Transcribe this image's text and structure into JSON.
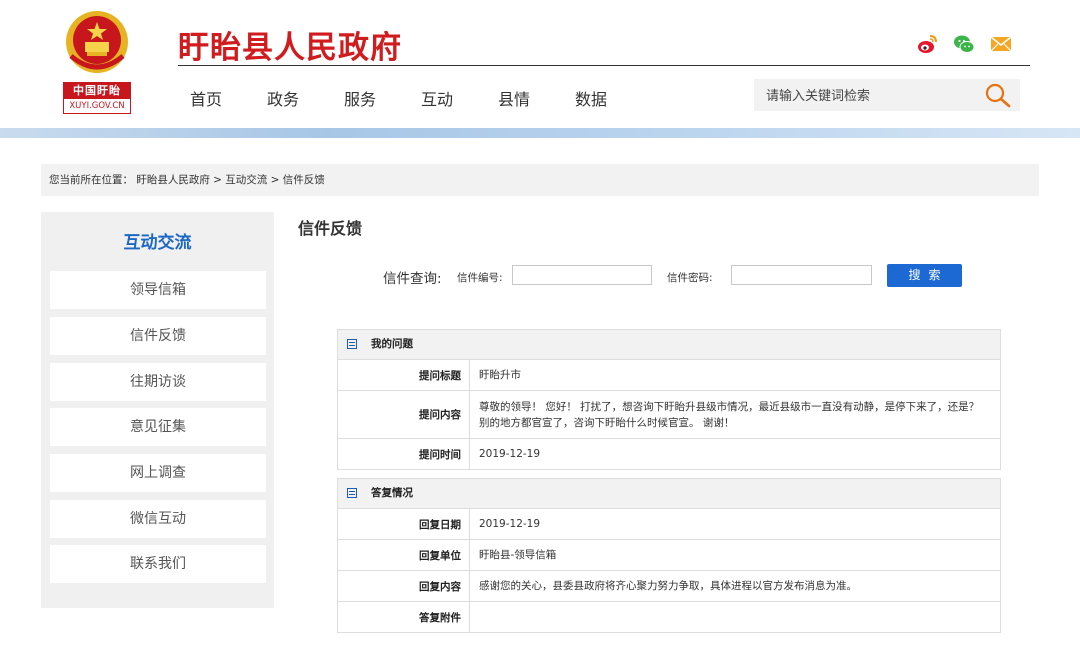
{
  "header": {
    "badge_top": "中国盱眙",
    "badge_bottom": "XUYI.GOV.CN",
    "site_title": "盱眙县人民政府",
    "social_icons": [
      "weibo-icon",
      "wechat-icon",
      "mail-icon"
    ]
  },
  "nav": {
    "items": [
      "首页",
      "政务",
      "服务",
      "互动",
      "县情",
      "数据"
    ]
  },
  "search": {
    "placeholder": "请输入关键词检索"
  },
  "breadcrumb": {
    "text": "您当前所在位置： 盱眙县人民政府 > 互动交流 > 信件反馈"
  },
  "sidebar": {
    "title": "互动交流",
    "items": [
      "领导信箱",
      "信件反馈",
      "往期访谈",
      "意见征集",
      "网上调查",
      "微信互动",
      "联系我们"
    ]
  },
  "main": {
    "title": "信件反馈",
    "query_label": "信件查询:",
    "number_label": "信件编号:",
    "password_label": "信件密码:",
    "search_button": "搜索"
  },
  "question": {
    "heading": "我的问题",
    "rows": [
      {
        "key": "提问标题",
        "value": "盱眙升市"
      },
      {
        "key": "提问内容",
        "value": "尊敬的领导！ 您好！ 打扰了，想咨询下盱眙升县级市情况，最近县级市一直没有动静，是停下来了，还是？别的地方都官宣了，咨询下盱眙什么时候官宣。 谢谢！"
      },
      {
        "key": "提问时间",
        "value": "2019-12-19"
      }
    ]
  },
  "reply": {
    "heading": "答复情况",
    "rows": [
      {
        "key": "回复日期",
        "value": "2019-12-19"
      },
      {
        "key": "回复单位",
        "value": "盱眙县-领导信箱"
      },
      {
        "key": "回复内容",
        "value": "感谢您的关心，县委县政府将齐心聚力努力争取，具体进程以官方发布消息为准。"
      },
      {
        "key": "答复附件",
        "value": ""
      }
    ]
  },
  "colors": {
    "brand_red": "#d01c1f",
    "accent_blue": "#1c69c4",
    "button_blue": "#1c69d3"
  }
}
